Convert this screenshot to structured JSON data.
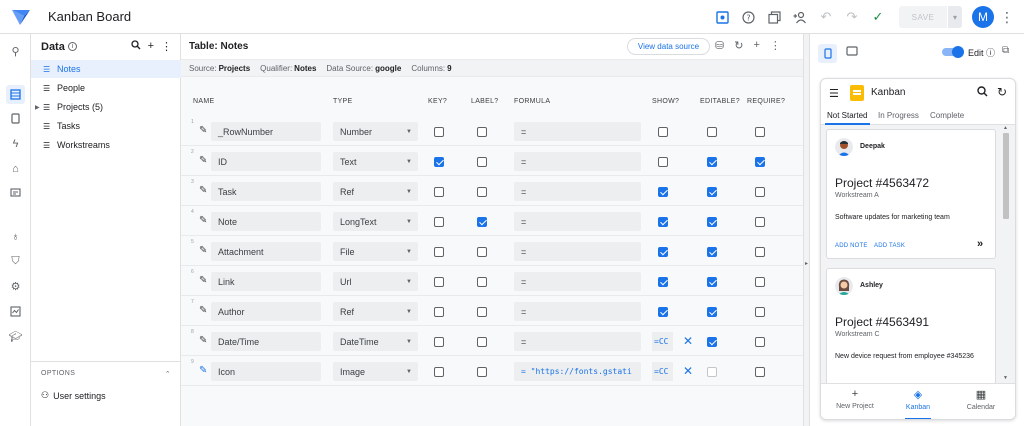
{
  "app": {
    "title": "Kanban Board",
    "user_initial": "M",
    "save_label": "SAVE"
  },
  "data_panel": {
    "title": "Data",
    "items": [
      {
        "label": "Notes",
        "active": true
      },
      {
        "label": "People"
      },
      {
        "label": "Projects (5)",
        "expandable": true
      },
      {
        "label": "Tasks"
      },
      {
        "label": "Workstreams"
      }
    ],
    "options_title": "OPTIONS",
    "user_settings": "User settings"
  },
  "table": {
    "title": "Table: Notes",
    "view_data_source": "View data source",
    "source_label": "Source:",
    "source_value": "Projects",
    "qualifier_label": "Qualifier:",
    "qualifier_value": "Notes",
    "datasource_label": "Data Source:",
    "datasource_value": "google",
    "columns_label": "Columns:",
    "columns_value": "9",
    "headers": {
      "name": "NAME",
      "type": "TYPE",
      "key": "KEY?",
      "label": "LABEL?",
      "formula": "FORMULA",
      "show": "SHOW?",
      "editable": "EDITABLE?",
      "require": "REQUIRE?"
    },
    "rows": [
      {
        "num": "1",
        "name": "_RowNumber",
        "type": "Number",
        "key": false,
        "label": false,
        "formula": "=",
        "show": false,
        "editable": false,
        "require": false
      },
      {
        "num": "2",
        "name": "ID",
        "type": "Text",
        "key": true,
        "label": false,
        "formula": "=",
        "show": false,
        "editable": true,
        "require": true
      },
      {
        "num": "3",
        "name": "Task",
        "type": "Ref",
        "key": false,
        "label": false,
        "formula": "=",
        "show": true,
        "editable": true,
        "require": false
      },
      {
        "num": "4",
        "name": "Note",
        "type": "LongText",
        "key": false,
        "label": true,
        "formula": "=",
        "show": true,
        "editable": true,
        "require": false
      },
      {
        "num": "5",
        "name": "Attachment",
        "type": "File",
        "key": false,
        "label": false,
        "formula": "=",
        "show": true,
        "editable": true,
        "require": false
      },
      {
        "num": "6",
        "name": "Link",
        "type": "Url",
        "key": false,
        "label": false,
        "formula": "=",
        "show": true,
        "editable": true,
        "require": false
      },
      {
        "num": "7",
        "name": "Author",
        "type": "Ref",
        "key": false,
        "label": false,
        "formula": "=",
        "show": true,
        "editable": true,
        "require": false
      },
      {
        "num": "8",
        "name": "Date/Time",
        "type": "DateTime",
        "key": false,
        "label": false,
        "formula": "=",
        "show_formula": "=CC",
        "editable": true,
        "require": false
      },
      {
        "num": "9",
        "name": "Icon",
        "type": "Image",
        "key": false,
        "label": false,
        "formula": "= \"https://fonts.gstati",
        "show_formula": "=CC",
        "editable": false,
        "editable_disabled": true,
        "require": false
      }
    ]
  },
  "preview": {
    "edit_label": "Edit",
    "app_title": "Kanban",
    "tabs": [
      "Not Started",
      "In Progress",
      "Complete"
    ],
    "cards": [
      {
        "name": "Deepak",
        "project": "Project #4563472",
        "workstream": "Workstream A",
        "description": "Software updates for marketing team",
        "action1": "ADD NOTE",
        "action2": "ADD TASK"
      },
      {
        "name": "Ashley",
        "project": "Project #4563491",
        "workstream": "Workstream C",
        "description": "New device request from employee #345236"
      }
    ],
    "nav": [
      "New Project",
      "Kanban",
      "Calendar"
    ]
  },
  "colors": {
    "accent": "#1a73e8",
    "active_bg": "#e8f0fe"
  }
}
